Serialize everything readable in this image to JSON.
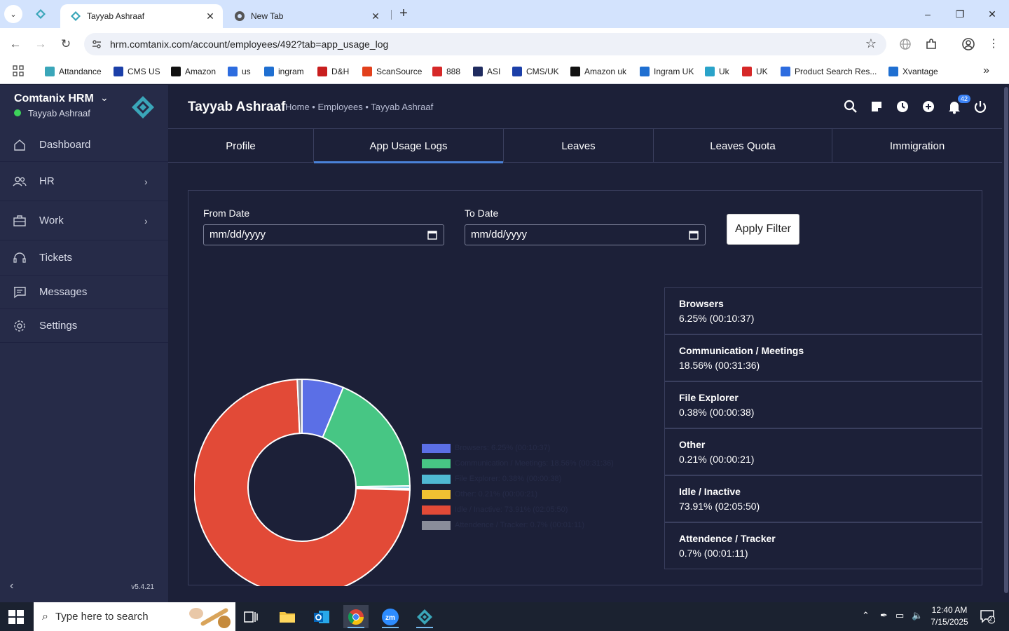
{
  "browser": {
    "tabs": [
      {
        "title": "Tayyab Ashraaf",
        "active": true
      },
      {
        "title": "New Tab",
        "active": false
      }
    ],
    "url": "hrm.comtanix.com/account/employees/492?tab=app_usage_log",
    "bookmarks": [
      {
        "label": "Attandance",
        "color": "#3aa6b9"
      },
      {
        "label": "CMS US",
        "color": "#1b3fa8"
      },
      {
        "label": "Amazon",
        "color": "#111111"
      },
      {
        "label": "us",
        "color": "#2d6cdf"
      },
      {
        "label": "ingram",
        "color": "#1f6fd1"
      },
      {
        "label": "D&H",
        "color": "#c81e1e"
      },
      {
        "label": "ScanSource",
        "color": "#e2401c"
      },
      {
        "label": "888",
        "color": "#d62828"
      },
      {
        "label": "ASI",
        "color": "#1f2b5f"
      },
      {
        "label": "CMS/UK",
        "color": "#1b3fa8"
      },
      {
        "label": "Amazon uk",
        "color": "#111111"
      },
      {
        "label": "Ingram UK",
        "color": "#1f6fd1"
      },
      {
        "label": "Uk",
        "color": "#2aa3c9"
      },
      {
        "label": "UK",
        "color": "#d62828"
      },
      {
        "label": "Product Search Res...",
        "color": "#2d6cdf"
      },
      {
        "label": "Xvantage",
        "color": "#1f6fd1"
      }
    ]
  },
  "sidebar": {
    "brand": "Comtanix HRM",
    "user": "Tayyab Ashraaf",
    "items": [
      {
        "label": "Dashboard",
        "icon": "home-icon",
        "has_children": false
      },
      {
        "label": "HR",
        "icon": "users-icon",
        "has_children": true
      },
      {
        "label": "Work",
        "icon": "briefcase-icon",
        "has_children": true
      },
      {
        "label": "Tickets",
        "icon": "headset-icon",
        "has_children": false
      },
      {
        "label": "Messages",
        "icon": "message-icon",
        "has_children": false
      },
      {
        "label": "Settings",
        "icon": "gear-icon",
        "has_children": false
      }
    ],
    "version": "v5.4.21"
  },
  "header": {
    "title": "Tayyab Ashraaf",
    "breadcrumb": "Home • Employees • Tayyab Ashraaf",
    "notification_count": "42"
  },
  "profile_tabs": [
    {
      "label": "Profile"
    },
    {
      "label": "App Usage Logs"
    },
    {
      "label": "Leaves"
    },
    {
      "label": "Leaves Quota"
    },
    {
      "label": "Immigration"
    }
  ],
  "active_tab": "App Usage Logs",
  "filter": {
    "from_label": "From Date",
    "to_label": "To Date",
    "from_value": "mm/dd/yyyy",
    "to_value": "mm/dd/yyyy",
    "apply_label": "Apply Filter"
  },
  "usage": [
    {
      "name": "Browsers",
      "value": "6.25% (00:10:37)",
      "legend": "Browsers: 6.25% (00:10:37)",
      "percent": 6.25,
      "color": "#5b6fe6"
    },
    {
      "name": "Communication / Meetings",
      "value": "18.56% (00:31:36)",
      "legend": "Communication / Meetings: 18.56% (00:31:36)",
      "percent": 18.56,
      "color": "#47c684"
    },
    {
      "name": "File Explorer",
      "value": "0.38% (00:00:38)",
      "legend": "File Explorer: 0.38% (00:00:38)",
      "percent": 0.38,
      "color": "#4fb9d3"
    },
    {
      "name": "Other",
      "value": "0.21% (00:00:21)",
      "legend": "Other: 0.21% (00:00:21)",
      "percent": 0.21,
      "color": "#f0c132"
    },
    {
      "name": "Idle / Inactive",
      "value": "73.91% (02:05:50)",
      "legend": "Idle / Inactive: 73.91% (02:05:50)",
      "percent": 73.91,
      "color": "#e24a37"
    },
    {
      "name": "Attendence / Tracker",
      "value": "0.7% (00:01:11)",
      "legend": "Attendence / Tracker: 0.7% (00:01:11)",
      "percent": 0.7,
      "color": "#8a8d9a"
    }
  ],
  "taskbar": {
    "search_placeholder": "Type here to search",
    "time": "12:40 AM",
    "date": "7/15/2025",
    "notification_count": "2"
  }
}
